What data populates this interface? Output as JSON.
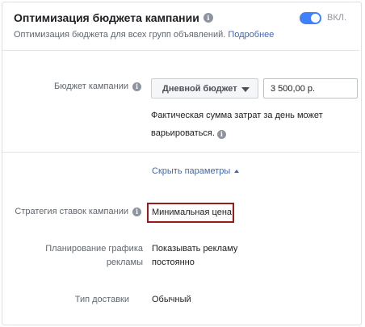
{
  "header": {
    "title": "Оптимизация бюджета кампании",
    "subtitle": "Оптимизация бюджета для всех групп объявлений.",
    "learn_more": "Подробнее",
    "toggle_label": "ВКЛ."
  },
  "budget": {
    "label": "Бюджет кампании",
    "type": "Дневной бюджет",
    "amount": "3 500,00 р.",
    "note": "Фактическая сумма затрат за день может варьироваться."
  },
  "toggle_link": "Скрыть параметры",
  "bid_strategy": {
    "label": "Стратегия ставок кампании",
    "value": "Минимальная цена"
  },
  "schedule": {
    "label_line1": "Планирование графика",
    "label_line2": "рекламы",
    "value_line1": "Показывать рекламу",
    "value_line2": "постоянно"
  },
  "delivery": {
    "label": "Тип доставки",
    "value": "Обычный"
  },
  "icons": {
    "info": "info-icon",
    "dropdown": "chevron-down-icon",
    "collapse": "chevron-up-icon"
  },
  "colors": {
    "accent": "#4267b2",
    "toggle_on": "#4080ff",
    "highlight_border": "#9b1b1b"
  }
}
